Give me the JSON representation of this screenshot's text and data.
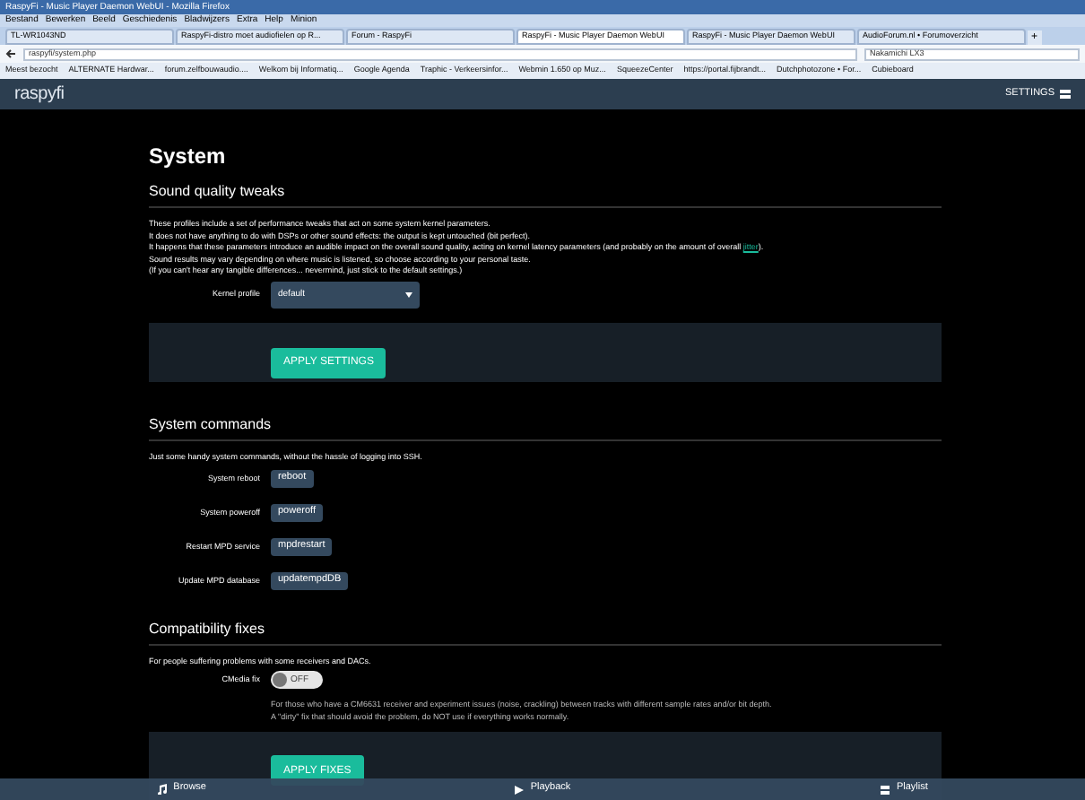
{
  "browser": {
    "title": "RaspyFi - Music Player Daemon WebUI - Mozilla Firefox",
    "menu": [
      "Bestand",
      "Bewerken",
      "Beeld",
      "Geschiedenis",
      "Bladwijzers",
      "Extra",
      "Help",
      "Minion"
    ],
    "tabs": [
      {
        "label": "TL-WR1043ND",
        "selected": false
      },
      {
        "label": "RaspyFi-distro moet audiofielen op R...",
        "selected": false
      },
      {
        "label": "Forum - RaspyFi",
        "selected": false
      },
      {
        "label": "RaspyFi - Music Player Daemon WebUI",
        "selected": true
      },
      {
        "label": "RaspyFi - Music Player Daemon WebUI",
        "selected": false
      },
      {
        "label": "AudioForum.nl • Forumoverzicht",
        "selected": false
      }
    ],
    "new_tab": "+",
    "url": "raspyfi/system.php",
    "search": "Nakamichi LX3",
    "bookmarks": [
      "Meest bezocht",
      "ALTERNATE Hardwar...",
      "forum.zelfbouwaudio....",
      "Welkom bij Informatiq...",
      "Google Agenda",
      "Traphic - Verkeersinfor...",
      "Webmin 1.650 op Muz...",
      "SqueezeCenter",
      "https://portal.fijbrandt...",
      "Dutchphotozone • For...",
      "Cubieboard"
    ]
  },
  "app": {
    "logo": "raspyfi",
    "settings": "SETTINGS"
  },
  "page_title": "System",
  "sound": {
    "heading": "Sound quality tweaks",
    "lines": [
      "These profiles include a set of performance tweaks that act on some system kernel parameters.",
      "It does not have anything to do with DSPs or other sound effects: the output is kept untouched (bit perfect).",
      "Sound results may vary depending on where music is listened, so choose according to your personal taste.",
      "(If you can't hear any tangible differences... nevermind, just stick to the default settings.)"
    ],
    "link_line": {
      "before": "It happens that these parameters introduce an audible impact on the overall sound quality, acting on kernel latency parameters (and probably on the amount of overall ",
      "link": "jitter",
      "after": ")."
    },
    "kernel_label": "Kernel profile",
    "kernel_value": "default",
    "apply": "APPLY SETTINGS"
  },
  "commands": {
    "heading": "System commands",
    "description": "Just some handy system commands, without the hassle of logging into SSH.",
    "items": [
      {
        "label": "System reboot",
        "button": "reboot"
      },
      {
        "label": "System poweroff",
        "button": "poweroff"
      },
      {
        "label": "Restart MPD service",
        "button": "mpdrestart"
      },
      {
        "label": "Update MPD database",
        "button": "updatempdDB"
      }
    ]
  },
  "compat": {
    "heading": "Compatibility fixes",
    "description": "For people suffering problems with some receivers and DACs.",
    "toggle": {
      "label": "CMedia fix",
      "state_text": "OFF",
      "on": false
    },
    "notes": [
      "For those who have a CM6631 receiver and experiment issues (noise, crackling) between tracks with different sample rates and/or bit depth.",
      "A \"dirty\" fix that should avoid the problem, do NOT use if everything works normally."
    ],
    "apply": "APPLY FIXES"
  },
  "footer": [
    {
      "kind": "browse",
      "label": "Browse"
    },
    {
      "kind": "playback",
      "label": "Playback"
    },
    {
      "kind": "playlist",
      "label": "Playlist"
    }
  ]
}
